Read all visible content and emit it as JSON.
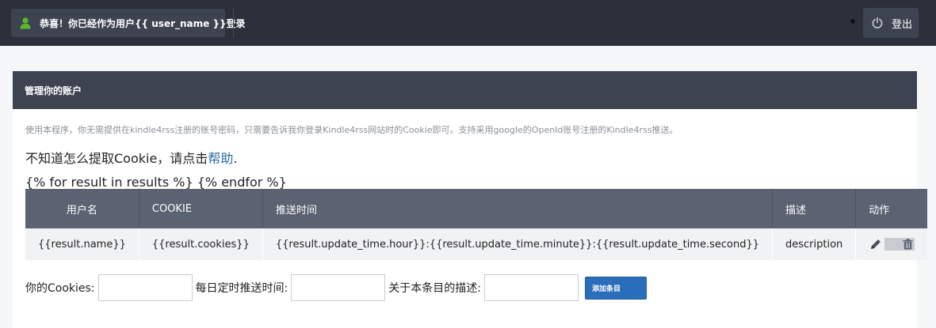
{
  "topbar": {
    "welcome_text": "恭喜！你已经作为用户{{ user_name }}登录",
    "logout_label": "登出"
  },
  "panel": {
    "title": "管理你的账户",
    "intro": "使用本程序，你无需提供在kindle4rss注册的账号密码，只需要告诉我你登录Kindle4rss网站时的Cookie即可。支持采用google的OpenId账号注册的Kindle4rss推送。",
    "howto_prefix": "不知道怎么提取Cookie，请点击",
    "howto_link": "帮助",
    "howto_suffix": ".",
    "loop_text": "{% for result in results %} {% endfor %}"
  },
  "table": {
    "headers": [
      "用户名",
      "COOKIE",
      "推送时间",
      "描述",
      "动作"
    ],
    "rows": [
      {
        "name": "{{result.name}}",
        "cookies": "{{result.cookies}}",
        "time": "{{result.update_time.hour}}:{{result.update_time.minute}}:{{result.update_time.second}}",
        "description": "description"
      }
    ]
  },
  "form": {
    "cookies_label": "你的Cookies:",
    "cookies_value": "",
    "time_label": "每日定时推送时间:",
    "time_value": "",
    "desc_label": "关于本条目的描述:",
    "desc_value": "",
    "add_button": "添加条目"
  },
  "icons": {
    "user": "user-icon",
    "power": "power-icon",
    "edit": "pencil-icon",
    "delete": "trash-icon"
  },
  "colors": {
    "topbar_bg": "#2b303b",
    "panel_header_bg": "#3d4350",
    "table_header_bg": "#5b6272",
    "accent_button": "#2a6ebb",
    "user_icon": "#5cb82a"
  }
}
